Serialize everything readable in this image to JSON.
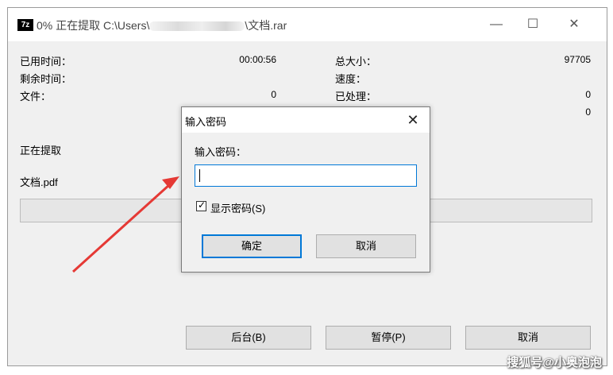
{
  "window": {
    "icon_text": "7z",
    "title_prefix": "0% 正在提取 C:\\Users\\",
    "title_suffix": "\\文档.rar",
    "minimize_icon": "minimize-icon",
    "maximize_icon": "maximize-icon",
    "close_icon": "close-icon"
  },
  "stats_left": [
    {
      "label": "已用时间：",
      "value": "00:00:56"
    },
    {
      "label": "剩余时间：",
      "value": ""
    },
    {
      "label": "文件：",
      "value": "0"
    }
  ],
  "stats_right": [
    {
      "label": "总大小：",
      "value": "97705"
    },
    {
      "label": "速度：",
      "value": ""
    },
    {
      "label": "已处理：",
      "value": "0"
    },
    {
      "label": "",
      "value": "0"
    }
  ],
  "status": {
    "text": "正在提取",
    "current_file": "文档.pdf",
    "progress": 0
  },
  "buttons": {
    "background": "后台(B)",
    "pause": "暂停(P)",
    "cancel": "取消"
  },
  "dialog": {
    "title": "输入密码",
    "label": "输入密码：",
    "password_value": "",
    "show_password_label": "显示密码(S)",
    "show_password_checked": true,
    "ok": "确定",
    "cancel": "取消"
  },
  "annotation": {
    "arrow_color": "#e53935"
  },
  "watermark": "搜狐号@小奥泡泡"
}
